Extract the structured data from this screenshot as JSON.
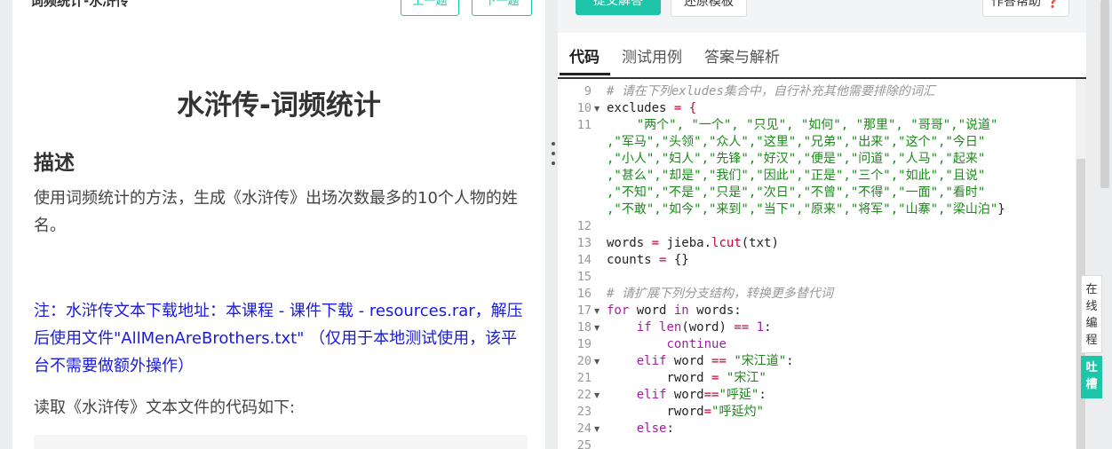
{
  "left": {
    "top_title": "词频统计-水浒传",
    "prev_btn": "上一题",
    "next_btn": "下一题",
    "title": "水浒传-词频统计",
    "section": "描述",
    "description": "使用词频统计的方法，生成《水浒传》出场次数最多的10个人物的姓名。",
    "note": "注：水浒传文本下载地址：本课程 - 课件下载 - resources.rar，解压后使用文件\"AllMenAreBrothers.txt\"  （仅用于本地测试使用，该平台不需要做额外操作）",
    "read_code": "读取《水浒传》文本文件的代码如下:"
  },
  "right": {
    "submit_btn": "提交解答",
    "reset_btn": "还原模板",
    "help_btn": "作答帮助 ❓",
    "tabs": [
      "代码",
      "测试用例",
      "答案与解析"
    ],
    "active_tab": "代码"
  },
  "editor": {
    "lines": [
      {
        "n": "9",
        "fold": false
      },
      {
        "n": "10",
        "fold": true
      },
      {
        "n": "11",
        "fold": false
      },
      {
        "n": "12",
        "fold": false
      },
      {
        "n": "13",
        "fold": false
      },
      {
        "n": "14",
        "fold": false
      },
      {
        "n": "15",
        "fold": false
      },
      {
        "n": "16",
        "fold": false
      },
      {
        "n": "17",
        "fold": true
      },
      {
        "n": "18",
        "fold": true
      },
      {
        "n": "19",
        "fold": false
      },
      {
        "n": "20",
        "fold": true
      },
      {
        "n": "21",
        "fold": false
      },
      {
        "n": "22",
        "fold": true
      },
      {
        "n": "23",
        "fold": false
      },
      {
        "n": "24",
        "fold": true
      },
      {
        "n": "25",
        "fold": false
      }
    ],
    "code": {
      "l9": "# 请在下列exludes集合中，自行补充其他需要排除的词汇",
      "l10a": "excludes",
      "l10b": " = {",
      "l11a": "    \"两个\", \"一个\", \"只见\", \"如何\", \"那里\", \"哥哥\",\"说道\"",
      "l11b": ",\"军马\",\"头领\",\"众人\",\"这里\",\"兄弟\",\"出来\",\"这个\",\"今日\"",
      "l11c": ",\"小人\",\"妇人\",\"先锋\",\"好汉\",\"便是\",\"问道\",\"人马\",\"起来\"",
      "l11d": ",\"甚么\",\"却是\",\"我们\",\"因此\",\"正是\",\"三个\",\"如此\",\"且说\"",
      "l11e": ",\"不知\",\"不是\",\"只是\",\"次日\",\"不曾\",\"不得\",\"一面\",\"看时\"",
      "l11f": ",\"不敢\",\"如今\",\"来到\",\"当下\",\"原来\",\"将军\",\"山寨\",\"梁山泊\"",
      "l11g": "}",
      "l13a": "words",
      "l13b": "jieba.",
      "l13c": "lcut",
      "l13d": "(txt)",
      "l14a": "counts",
      "l14b": "{}",
      "l16": "# 请扩展下列分支结构，转换更多替代词",
      "l17a": "for",
      "l17b": " word ",
      "l17c": "in",
      "l17d": " words:",
      "l18a": "if",
      "l18b": "len",
      "l18c": "(word)",
      "l18d": "==",
      "l18e": "1",
      "l18f": ":",
      "l19": "continue",
      "l20a": "elif",
      "l20b": " word ",
      "l20c": "==",
      "l20d": "\"宋江道\"",
      "l20e": ":",
      "l21a": "rword",
      "l21b": "\"宋江\"",
      "l22a": "elif",
      "l22b": " word",
      "l22c": "==",
      "l22d": "\"呼延\"",
      "l22e": ":",
      "l23a": "rword",
      "l23b": "\"呼延灼\"",
      "l24a": "else",
      "l24b": ":"
    }
  },
  "side": {
    "online_edit": "在线编程",
    "feedback": "吐槽"
  }
}
